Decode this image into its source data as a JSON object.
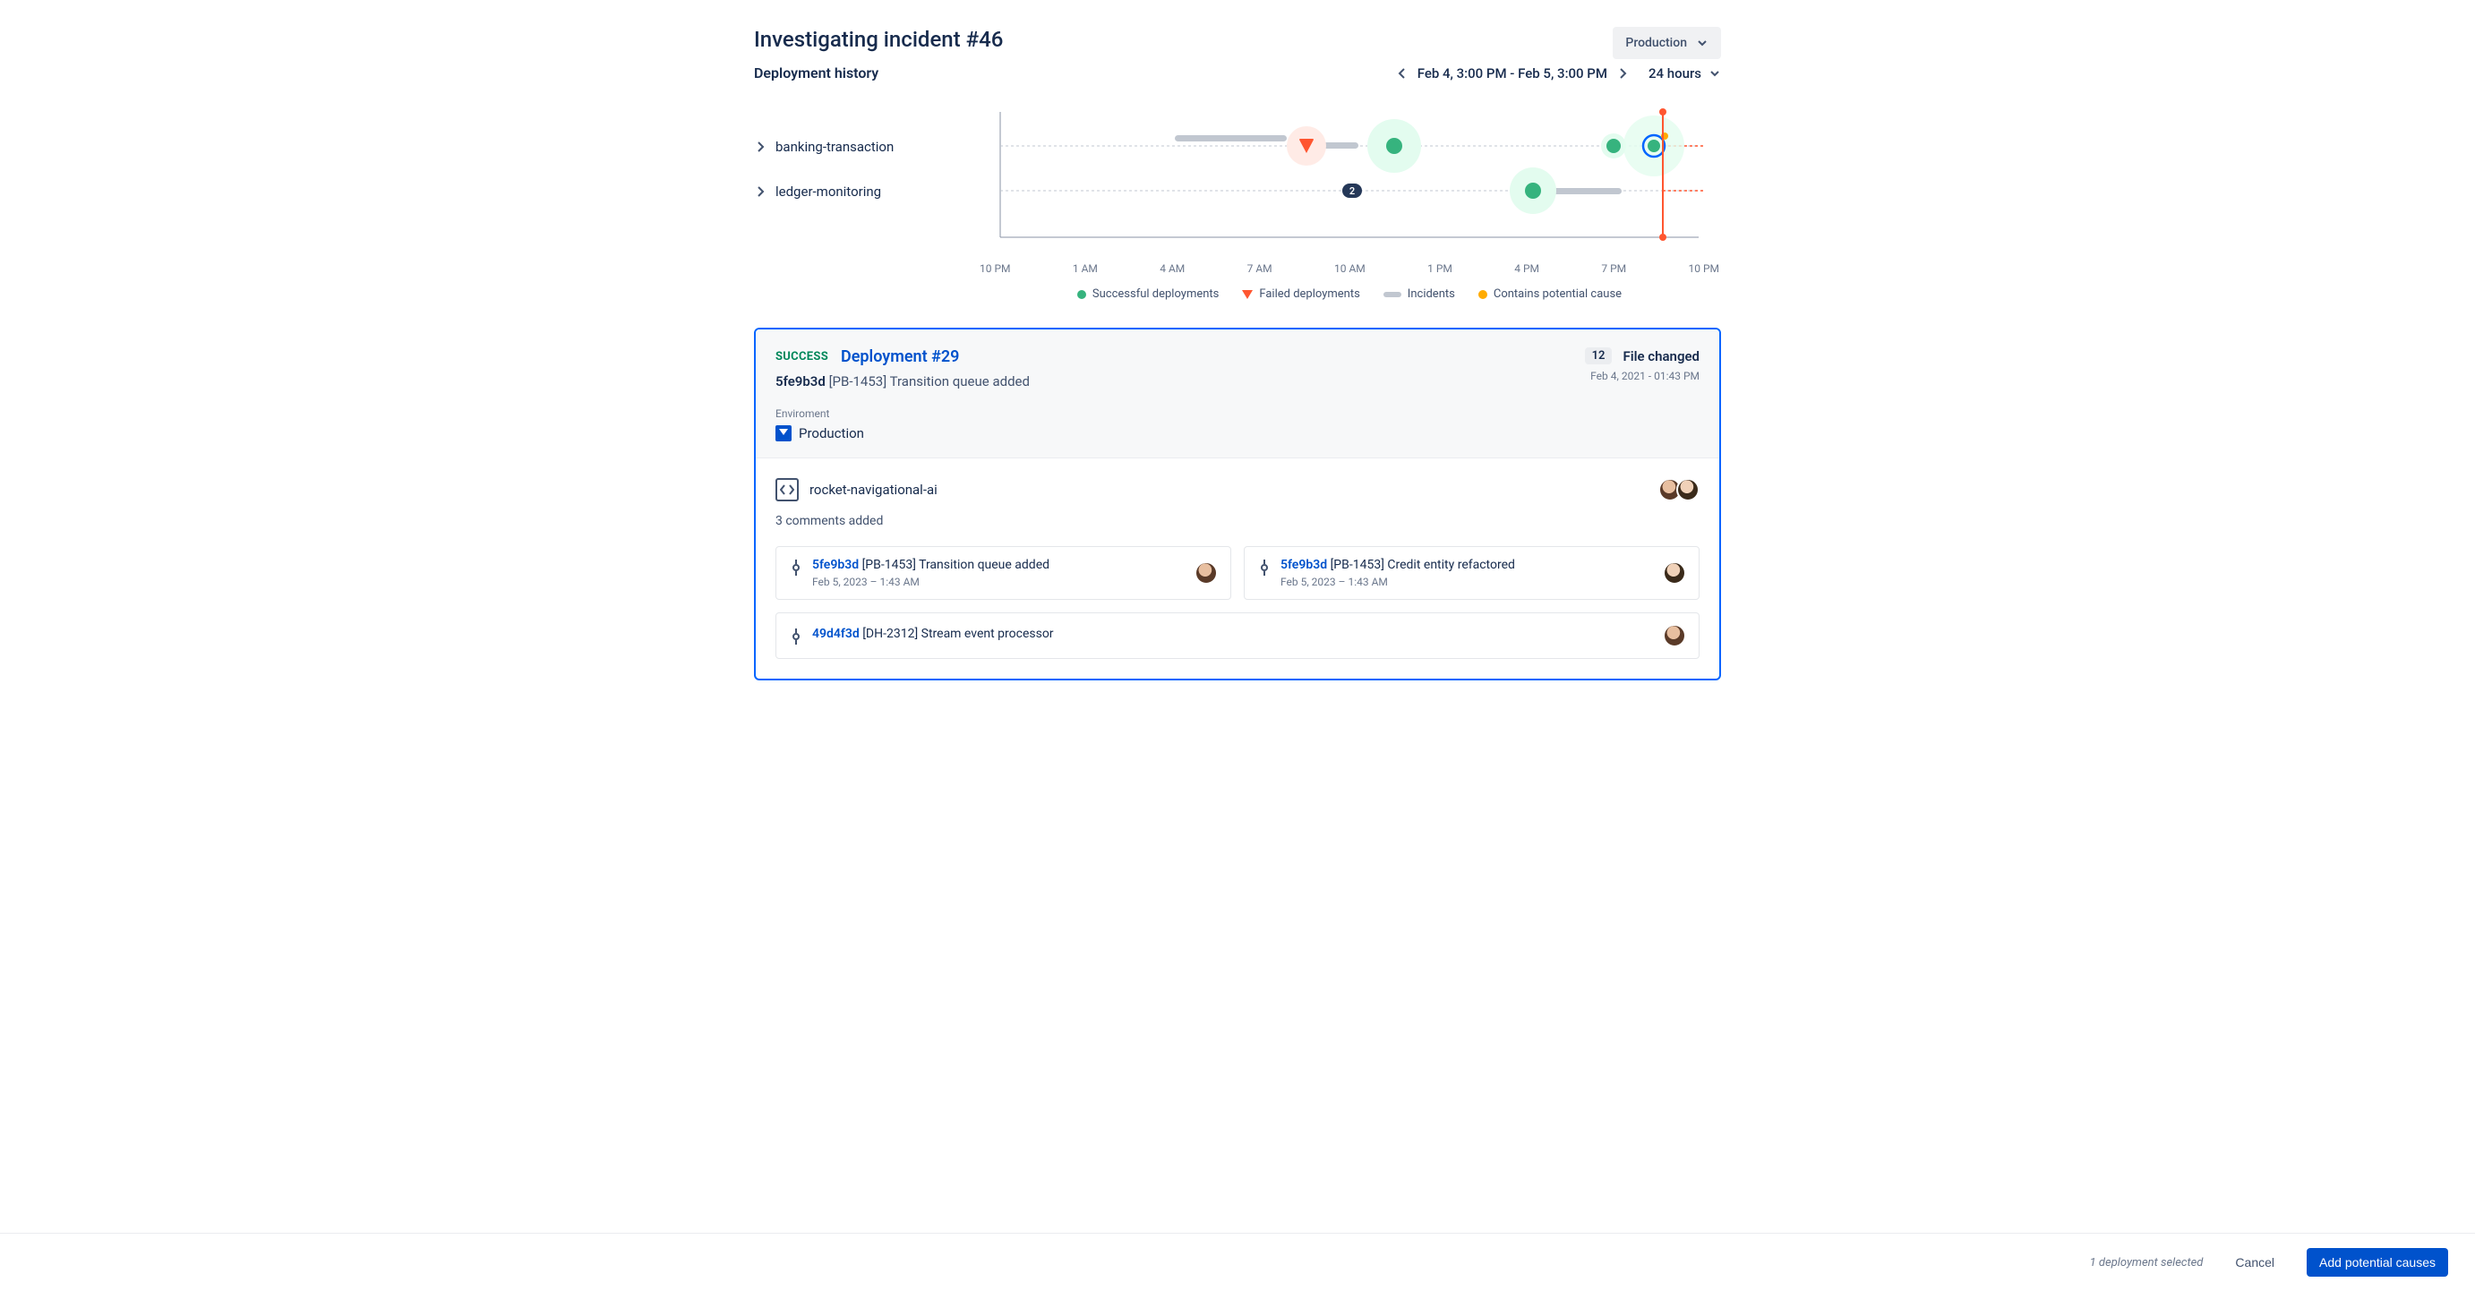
{
  "page_title": "Investigating incident #46",
  "section_title": "Deployment history",
  "env_selector": "Production",
  "date_range": "Feb 4, 3:00 PM - Feb 5, 3:00 PM",
  "time_window": "24 hours",
  "timeline": {
    "rows": [
      {
        "label": "banking-transaction"
      },
      {
        "label": "ledger-monitoring"
      }
    ],
    "x_ticks": [
      "10 PM",
      "1 AM",
      "4 AM",
      "7 AM",
      "10 AM",
      "1 PM",
      "4 PM",
      "7 PM",
      "10 PM"
    ],
    "cluster_count": "2",
    "legend": {
      "success": "Successful deployments",
      "failed": "Failed deployments",
      "incidents": "Incidents",
      "potential": "Contains potential cause"
    }
  },
  "chart_data": {
    "type": "scatter",
    "x_axis_ticks_hours_from_start": [
      0,
      3,
      6,
      9,
      12,
      15,
      18,
      21,
      24
    ],
    "x_axis_tick_labels": [
      "10 PM",
      "1 AM",
      "4 AM",
      "7 AM",
      "10 AM",
      "1 PM",
      "4 PM",
      "7 PM",
      "10 PM"
    ],
    "series": [
      {
        "name": "banking-transaction",
        "incidents": [
          {
            "start_hour": 6.0,
            "end_hour": 9.8
          },
          {
            "start_hour": 9.8,
            "end_hour": 12.3
          }
        ],
        "deployments": [
          {
            "hour": 10.5,
            "status": "failed",
            "magnitude": 2
          },
          {
            "hour": 13.5,
            "status": "success",
            "magnitude": 2
          },
          {
            "hour": 21.0,
            "status": "success",
            "magnitude": 1
          },
          {
            "hour": 22.5,
            "status": "success",
            "magnitude": 3,
            "selected": true,
            "contains_potential_cause": true
          }
        ]
      },
      {
        "name": "ledger-monitoring",
        "incidents": [
          {
            "start_hour": 18.3,
            "end_hour": 21.3
          }
        ],
        "deployments": [
          {
            "hour": 18.3,
            "status": "success",
            "magnitude": 2
          }
        ],
        "cluster_badge": {
          "hour": 12.0,
          "count": 2
        }
      }
    ],
    "current_time_marker_hour": 22.8
  },
  "deployment": {
    "status": "SUCCESS",
    "title": "Deployment #29",
    "commit_hash": "5fe9b3d",
    "commit_msg": "[PB-1453] Transition queue added",
    "file_count": "12",
    "file_changed_label": "File changed",
    "timestamp": "Feb 4, 2021 - 01:43 PM",
    "env_label": "Enviroment",
    "env_value": "Production",
    "repo": "rocket-navigational-ai",
    "comments_added": "3 comments added",
    "commits": [
      {
        "hash": "5fe9b3d",
        "msg": "[PB-1453] Transition queue added",
        "time": "Feb 5, 2023 – 1:43 AM"
      },
      {
        "hash": "5fe9b3d",
        "msg": "[PB-1453] Credit entity refactored",
        "time": "Feb 5, 2023 – 1:43 AM"
      },
      {
        "hash": "49d4f3d",
        "msg": "[DH-2312] Stream event processor",
        "time": ""
      }
    ]
  },
  "footer": {
    "selected": "1 deployment selected",
    "cancel": "Cancel",
    "add": "Add potential causes"
  }
}
